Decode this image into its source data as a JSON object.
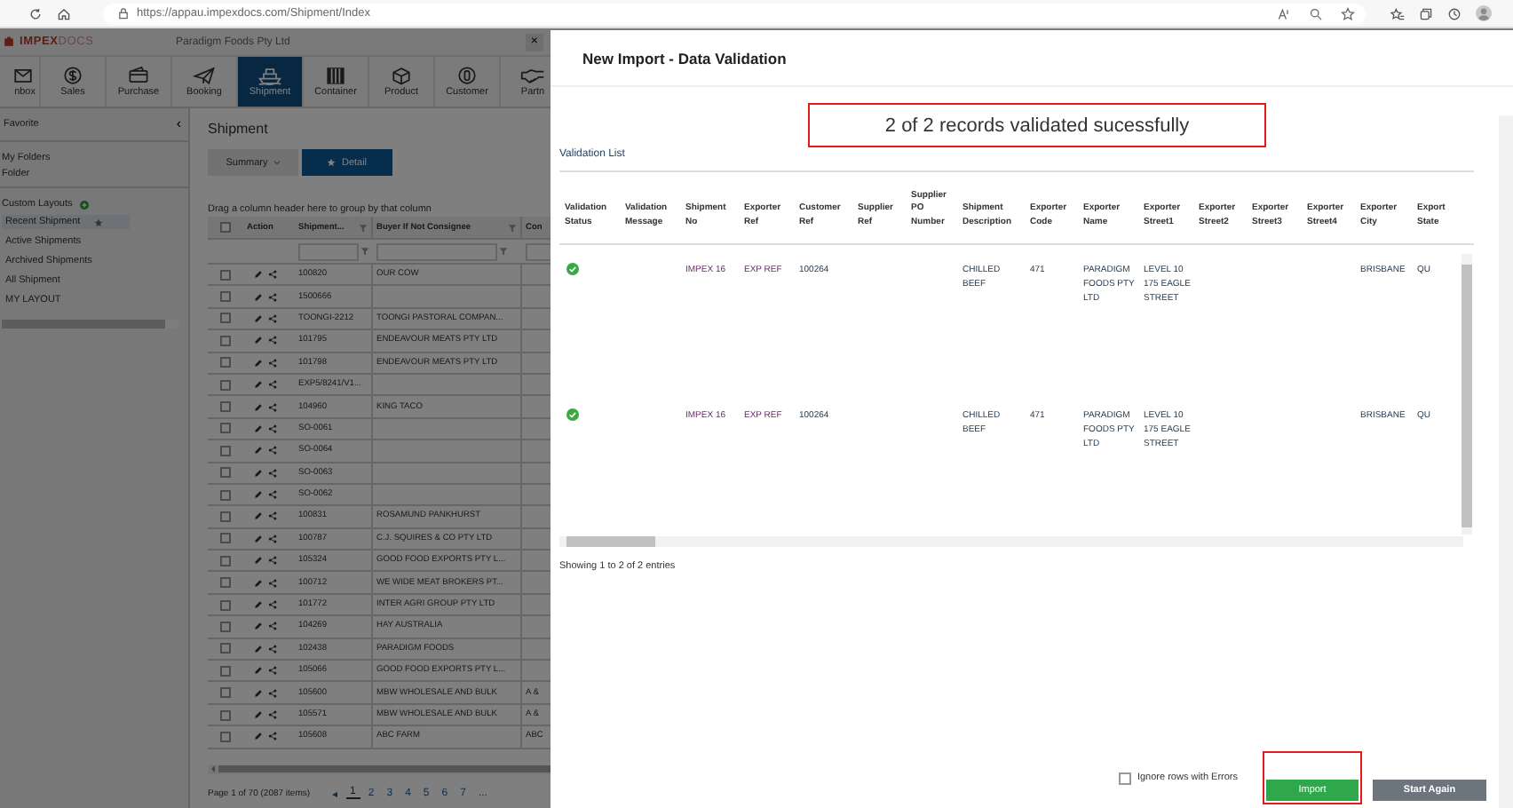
{
  "browser": {
    "url": "https://appau.impexdocs.com/Shipment/Index"
  },
  "app": {
    "logo_bold": "IMPEX",
    "logo_light": "DOCS",
    "company": "Paradigm Foods Pty Ltd",
    "close": "×"
  },
  "nav": [
    {
      "label": "nbox",
      "selected": false
    },
    {
      "label": "Sales",
      "selected": false
    },
    {
      "label": "Purchase",
      "selected": false
    },
    {
      "label": "Booking",
      "selected": false
    },
    {
      "label": "Shipment",
      "selected": true
    },
    {
      "label": "Container",
      "selected": false
    },
    {
      "label": "Product",
      "selected": false
    },
    {
      "label": "Customer",
      "selected": false
    },
    {
      "label": "Partn",
      "selected": false
    }
  ],
  "sidebar": {
    "favorites": "Favorite",
    "collapse": "‹",
    "folders_title": "My Folders",
    "folders": [
      "Folder"
    ],
    "layouts_title": "Custom Layouts",
    "layouts": [
      {
        "label": "Recent Shipment",
        "selected": true
      },
      {
        "label": "Active Shipments",
        "selected": false
      },
      {
        "label": "Archived Shipments",
        "selected": false
      },
      {
        "label": "All Shipment",
        "selected": false
      },
      {
        "label": "MY LAYOUT",
        "selected": false
      }
    ]
  },
  "main": {
    "title": "Shipment",
    "views": [
      {
        "label": "Summary",
        "kind": "dropdown",
        "selected": false
      },
      {
        "label": "Detail",
        "kind": "starred",
        "selected": true
      }
    ],
    "group_hint": "Drag a column header here to group by that column",
    "select_all_checked": false,
    "columns": [
      "Action",
      "Shipment...",
      "Buyer If Not Consignee",
      "Con"
    ],
    "rows": [
      {
        "checked": false,
        "shipment": "100820",
        "buyer": "OUR COW"
      },
      {
        "checked": false,
        "shipment": "1500666"
      },
      {
        "checked": false,
        "shipment": "TOONGI-2212",
        "buyer": "TOONGI PASTORAL COMPAN..."
      },
      {
        "checked": false,
        "shipment": "101795",
        "buyer": "ENDEAVOUR MEATS PTY LTD"
      },
      {
        "checked": false,
        "shipment": "101798",
        "buyer": "ENDEAVOUR MEATS PTY LTD"
      },
      {
        "checked": false,
        "shipment": "EXP5/8241/V1..."
      },
      {
        "checked": false,
        "shipment": "104960",
        "buyer": "KING TACO"
      },
      {
        "checked": false,
        "shipment": "SO-0061"
      },
      {
        "checked": false,
        "shipment": "SO-0064"
      },
      {
        "checked": false,
        "shipment": "SO-0063"
      },
      {
        "checked": false,
        "shipment": "SO-0062"
      },
      {
        "checked": false,
        "shipment": "100831",
        "buyer": "ROSAMUND PANKHURST"
      },
      {
        "checked": false,
        "shipment": "100787",
        "buyer": "C.J. SQUIRES & CO PTY LTD"
      },
      {
        "checked": false,
        "shipment": "105324",
        "buyer": "GOOD FOOD EXPORTS PTY L..."
      },
      {
        "checked": false,
        "shipment": "100712",
        "buyer": "WE WIDE MEAT BROKERS PT..."
      },
      {
        "checked": false,
        "shipment": "101772",
        "buyer": "INTER AGRI GROUP PTY LTD"
      },
      {
        "checked": false,
        "shipment": "104269",
        "buyer": "HAY AUSTRALIA"
      },
      {
        "checked": false,
        "shipment": "102438",
        "buyer": "PARADIGM FOODS"
      },
      {
        "checked": false,
        "shipment": "105066",
        "buyer": "GOOD FOOD EXPORTS PTY L..."
      },
      {
        "checked": false,
        "shipment": "105600",
        "buyer": "MBW WHOLESALE AND BULK",
        "consignee": "A &"
      },
      {
        "checked": false,
        "shipment": "105571",
        "buyer": "MBW WHOLESALE AND BULK",
        "consignee": "A &"
      },
      {
        "checked": false,
        "shipment": "105608",
        "buyer": "ABC FARM",
        "consignee": "ABC"
      }
    ],
    "pager": {
      "summary": "Page 1 of 70 (2087 items)",
      "prev": "◂",
      "pages": [
        {
          "label": "1",
          "selected": true
        },
        {
          "label": "2",
          "selected": false
        },
        {
          "label": "3",
          "selected": false
        },
        {
          "label": "4",
          "selected": false
        },
        {
          "label": "5",
          "selected": false
        },
        {
          "label": "6",
          "selected": false
        },
        {
          "label": "7",
          "selected": false
        }
      ],
      "more": "..."
    }
  },
  "modal": {
    "title": "New Import - Data Validation",
    "message": {
      "text": "2 of 2 records validated sucessfully",
      "highlighted": true
    },
    "list_title": "Validation List",
    "columns": [
      "Validation Status",
      "Validation Message",
      "Shipment No",
      "Exporter Ref",
      "Customer Ref",
      "Supplier Ref",
      "Supplier PO Number",
      "Shipment Description",
      "Exporter Code",
      "Exporter Name",
      "Exporter Street1",
      "Exporter Street2",
      "Exporter Street3",
      "Exporter Street4",
      "Exporter City",
      "Export State"
    ],
    "rows": [
      {
        "valid": true,
        "cells": [
          "",
          "",
          "IMPEX 16",
          "EXP REF",
          "100264",
          "",
          "",
          "CHILLED BEEF",
          "471",
          "PARADIGM FOODS PTY LTD",
          "LEVEL 10 175 EAGLE STREET",
          "",
          "",
          "",
          "BRISBANE",
          "QU"
        ]
      },
      {
        "valid": true,
        "cells": [
          "",
          "",
          "IMPEX 16",
          "EXP REF",
          "100264",
          "",
          "",
          "CHILLED BEEF",
          "471",
          "PARADIGM FOODS PTY LTD",
          "LEVEL 10 175 EAGLE STREET",
          "",
          "",
          "",
          "BRISBANE",
          "QU"
        ]
      }
    ],
    "entries": "Showing 1 to 2 of 2 entries",
    "ignore_errors": {
      "label": "Ignore rows with Errors",
      "checked": false
    },
    "buttons": [
      {
        "label": "Import",
        "kind": "primary",
        "highlighted": true
      },
      {
        "label": "Start Again",
        "kind": "secondary",
        "highlighted": false
      }
    ]
  }
}
